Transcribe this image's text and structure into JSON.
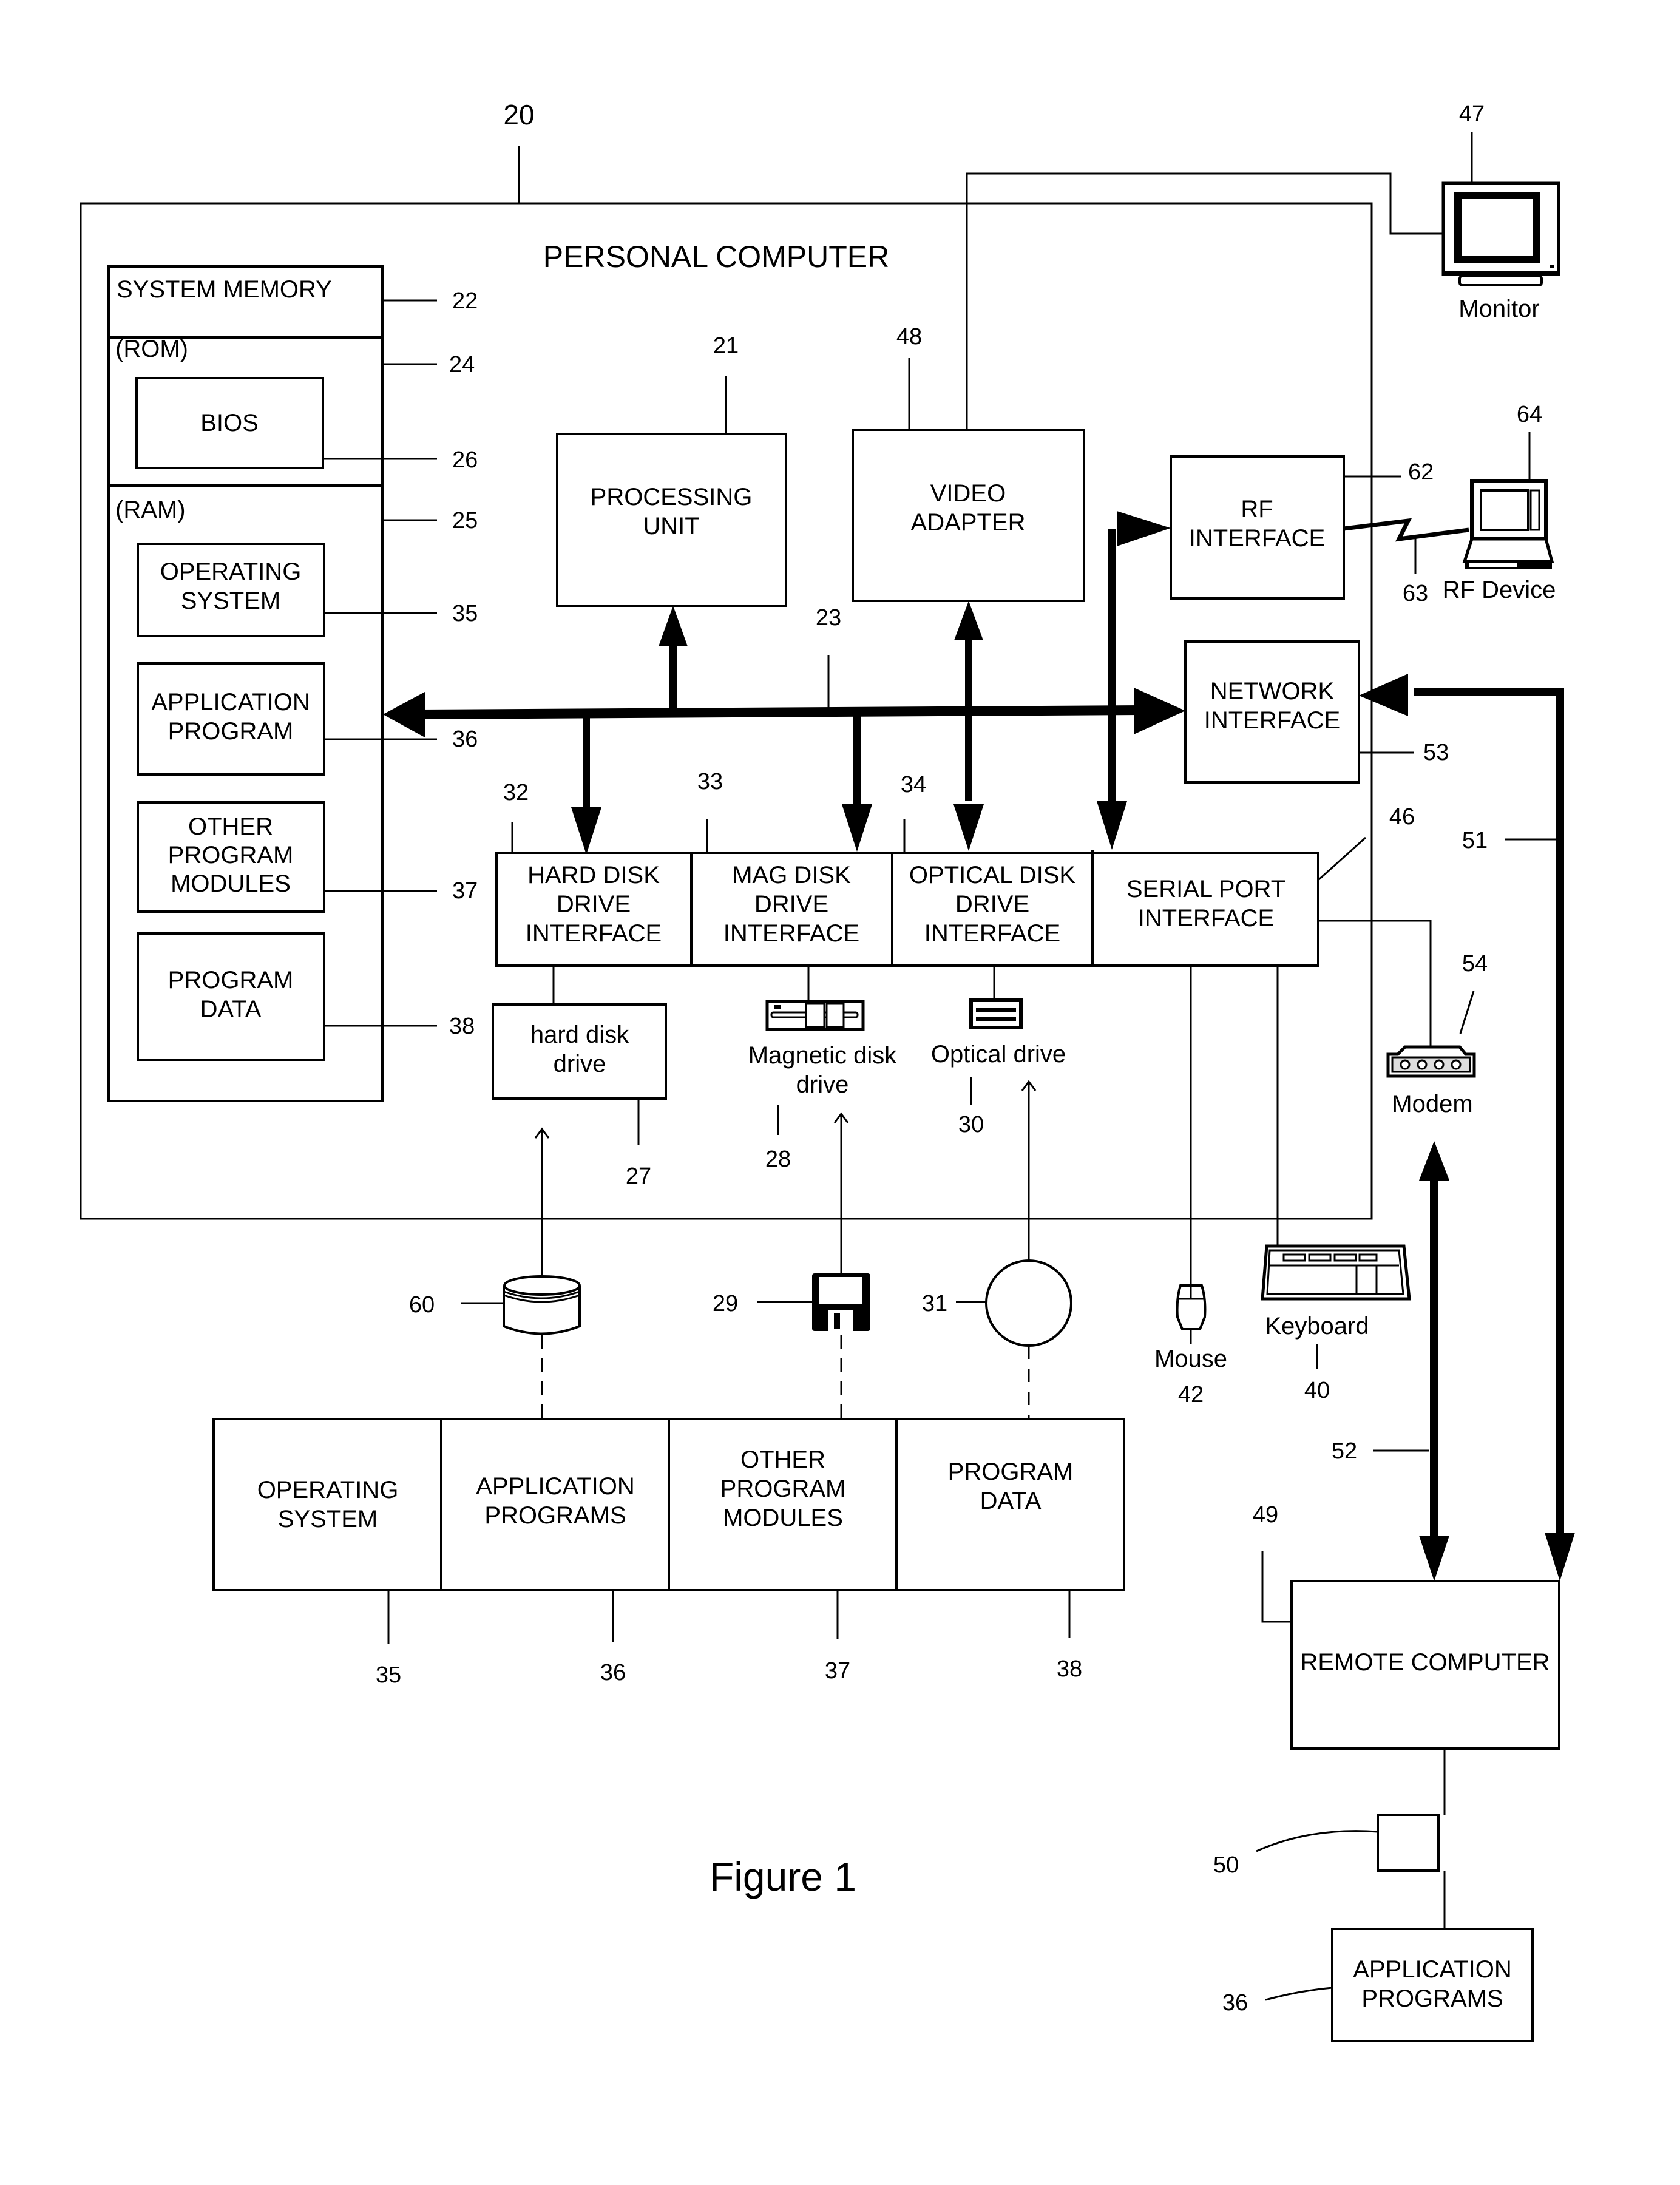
{
  "figure": {
    "caption": "Figure 1",
    "container": {
      "title": "PERSONAL COMPUTER",
      "ref": "20"
    }
  },
  "system_memory": {
    "label": "SYSTEM MEMORY",
    "ref": "22",
    "rom": {
      "label": "(ROM)",
      "ref": "24",
      "bios": {
        "label": "BIOS",
        "ref": "26"
      }
    },
    "ram": {
      "label": "(RAM)",
      "ref": "25",
      "items": [
        {
          "lines": [
            "OPERATING",
            "SYSTEM"
          ],
          "ref": "35"
        },
        {
          "lines": [
            "APPLICATION",
            "PROGRAM"
          ],
          "ref": "36"
        },
        {
          "lines": [
            "OTHER",
            "PROGRAM",
            "MODULES"
          ],
          "ref": "37"
        },
        {
          "lines": [
            "PROGRAM",
            "DATA"
          ],
          "ref": "38"
        }
      ]
    }
  },
  "processing_unit": {
    "lines": [
      "PROCESSING",
      "UNIT"
    ],
    "ref": "21"
  },
  "video_adapter": {
    "lines": [
      "VIDEO",
      "ADAPTER"
    ],
    "ref": "48"
  },
  "system_bus": {
    "ref": "23"
  },
  "rf_interface": {
    "lines": [
      "RF",
      "INTERFACE"
    ],
    "ref": "62",
    "link_ref": "63"
  },
  "network_interface": {
    "lines": [
      "NETWORK",
      "INTERFACE"
    ],
    "ref": "53"
  },
  "interfaces": [
    {
      "lines": [
        "HARD DISK",
        "DRIVE",
        "INTERFACE"
      ],
      "ref": "32"
    },
    {
      "lines": [
        "MAG DISK",
        "DRIVE",
        "INTERFACE"
      ],
      "ref": "33"
    },
    {
      "lines": [
        "OPTICAL DISK",
        "DRIVE",
        "INTERFACE"
      ],
      "ref": "34"
    },
    {
      "lines": [
        "SERIAL PORT",
        "INTERFACE"
      ],
      "ref": "46"
    }
  ],
  "drives": {
    "hard_disk": {
      "lines": [
        "hard disk",
        "drive"
      ],
      "ref": "27"
    },
    "magnetic": {
      "lines": [
        "Magnetic disk",
        "drive"
      ],
      "ref": "28"
    },
    "optical": {
      "label": "Optical drive",
      "ref": "30"
    }
  },
  "media": {
    "hard_disk_media": {
      "ref": "60"
    },
    "floppy": {
      "ref": "29"
    },
    "optical_disc": {
      "ref": "31"
    }
  },
  "peripherals": {
    "monitor": {
      "label": "Monitor",
      "ref": "47"
    },
    "rf_device": {
      "label": "RF Device",
      "ref": "64"
    },
    "modem": {
      "label": "Modem",
      "ref": "54"
    },
    "mouse": {
      "label": "Mouse",
      "ref": "42"
    },
    "keyboard": {
      "label": "Keyboard",
      "ref": "40"
    }
  },
  "stored_software": {
    "cells": [
      {
        "lines": [
          "OPERATING",
          "SYSTEM"
        ],
        "ref": "35"
      },
      {
        "lines": [
          "APPLICATION",
          "PROGRAMS"
        ],
        "ref": "36"
      },
      {
        "lines": [
          "OTHER",
          "PROGRAM",
          "MODULES"
        ],
        "ref": "37"
      },
      {
        "lines": [
          "PROGRAM",
          "DATA"
        ],
        "ref": "38"
      }
    ]
  },
  "network": {
    "lan_ref": "51",
    "wan_ref": "52",
    "remote_computer": {
      "label": "REMOTE COMPUTER",
      "ref": "49"
    },
    "storage_ref": "50",
    "remote_apps": {
      "lines": [
        "APPLICATION",
        "PROGRAMS"
      ],
      "ref": "36"
    }
  }
}
